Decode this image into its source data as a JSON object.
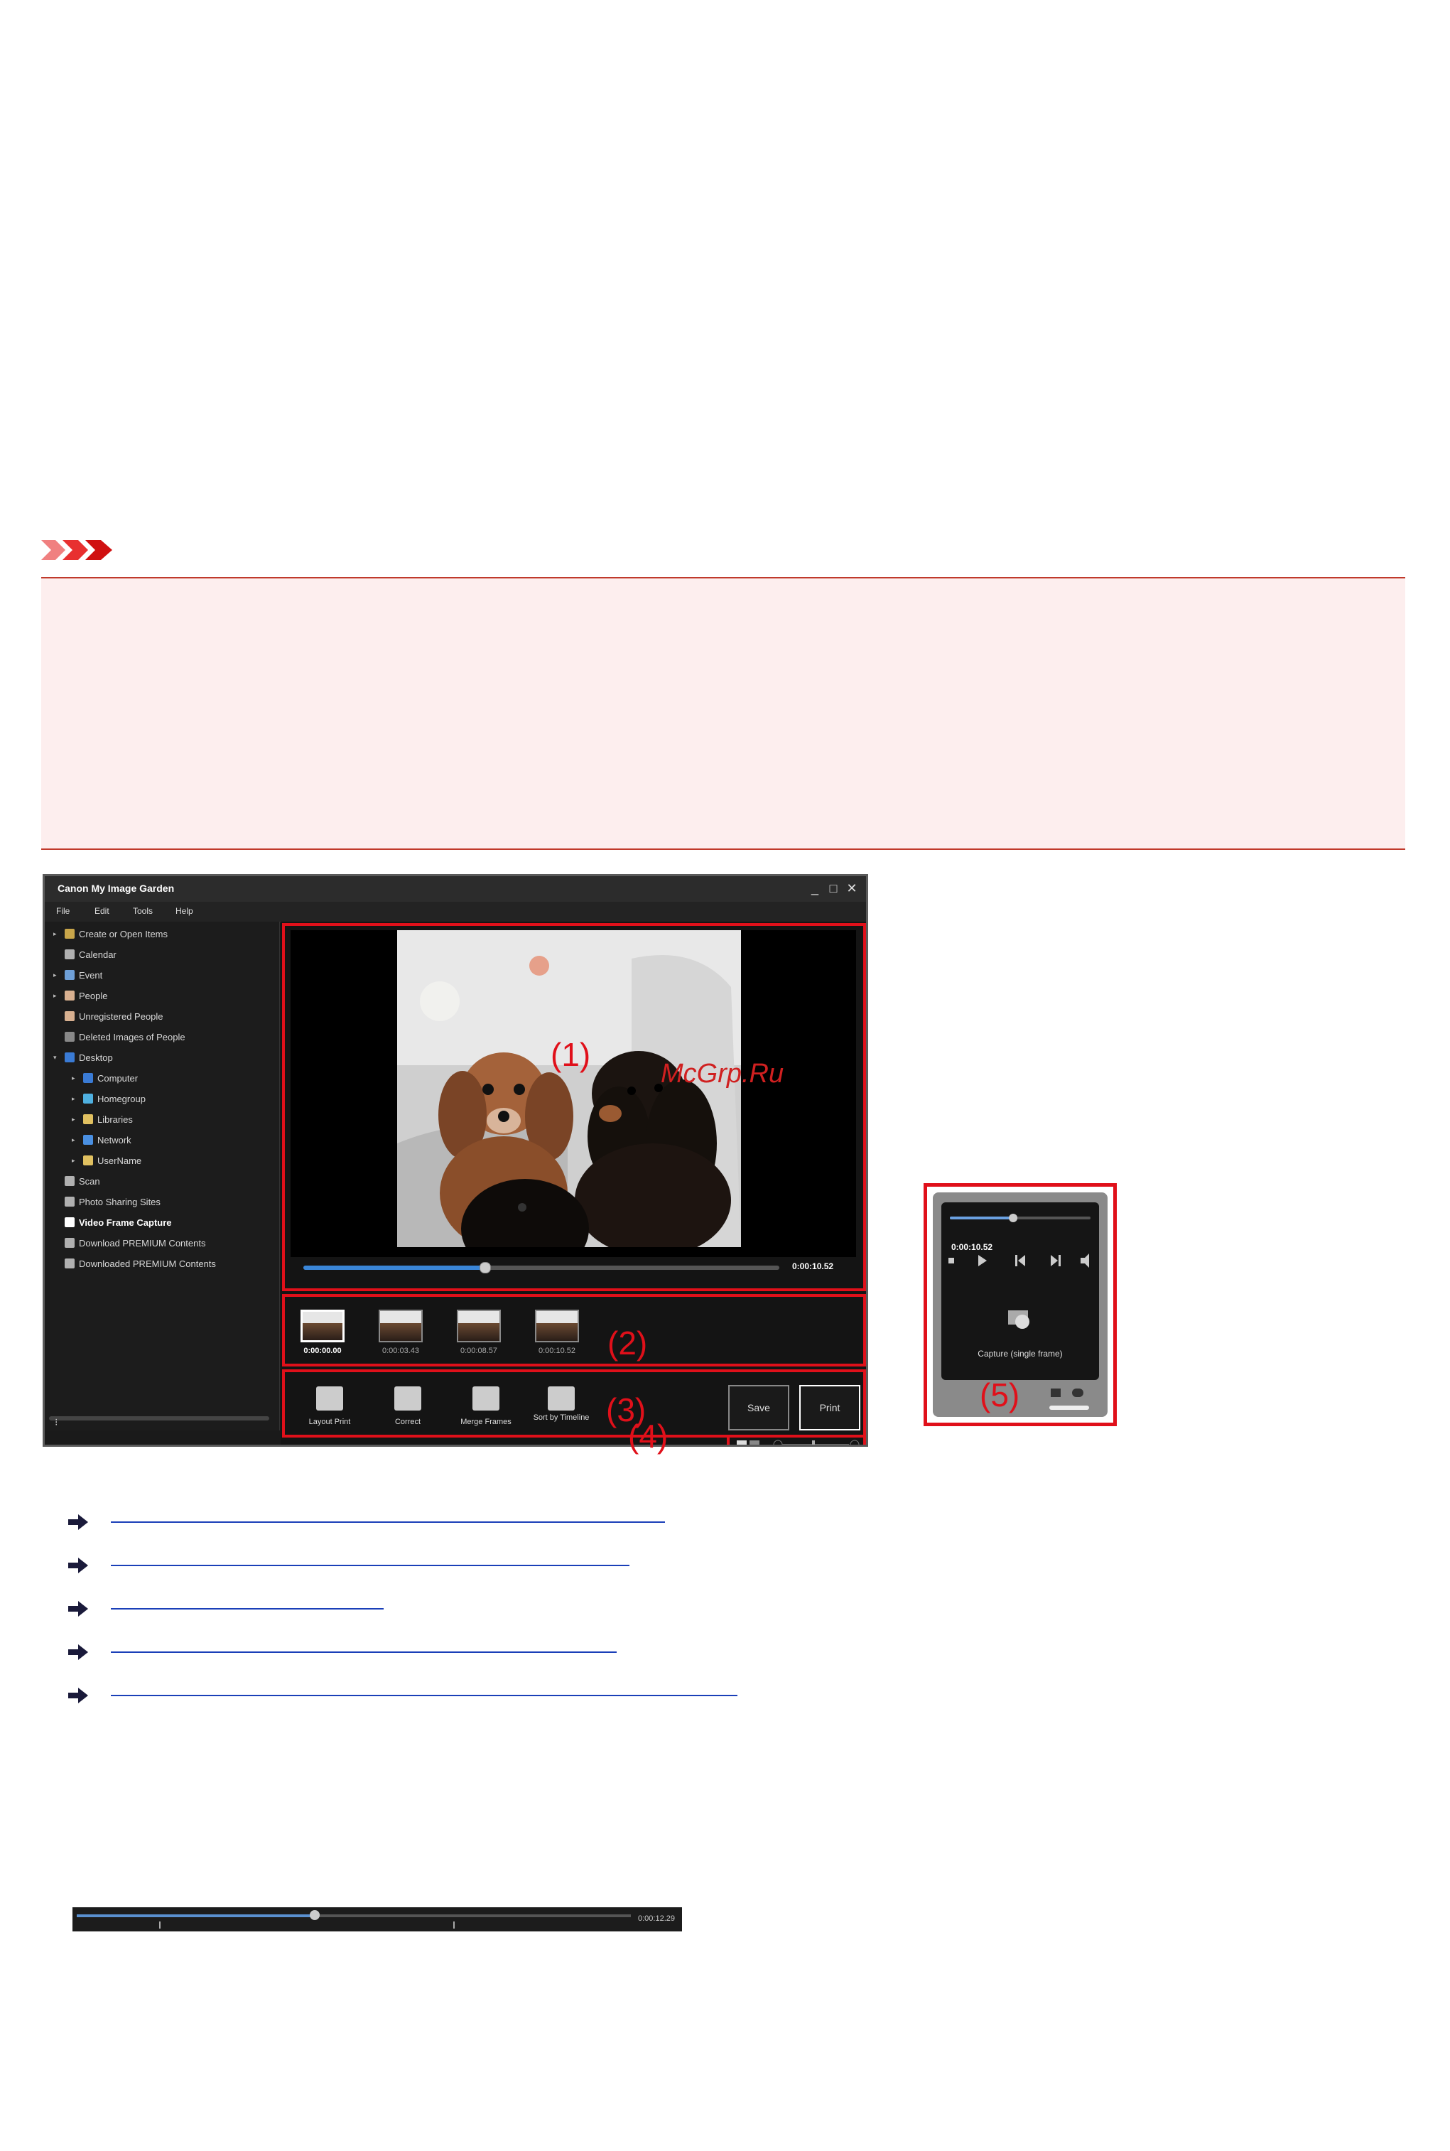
{
  "app": {
    "title": "Canon My Image Garden",
    "menu": [
      "File",
      "Edit",
      "Tools",
      "Help"
    ],
    "window_controls": [
      "_",
      "□",
      "✕"
    ]
  },
  "sidebar": {
    "items": [
      {
        "label": "Create or Open Items",
        "arrow": "▸",
        "icon": "create-icon",
        "color": "#c9a64a",
        "bold": false
      },
      {
        "label": "Calendar",
        "arrow": "",
        "icon": "calendar-icon",
        "color": "#b0b0b0",
        "bold": false
      },
      {
        "label": "Event",
        "arrow": "▸",
        "icon": "event-icon",
        "color": "#6fa0d8",
        "bold": false
      },
      {
        "label": "People",
        "arrow": "▸",
        "icon": "people-icon",
        "color": "#d8b090",
        "bold": false
      },
      {
        "label": "Unregistered People",
        "arrow": "",
        "icon": "person-icon",
        "color": "#d8b090",
        "bold": false
      },
      {
        "label": "Deleted Images of People",
        "arrow": "",
        "icon": "deleted-person-icon",
        "color": "#888888",
        "bold": false
      },
      {
        "label": "Desktop",
        "arrow": "▾",
        "icon": "desktop-icon",
        "color": "#3a7bd5",
        "bold": false
      },
      {
        "label": "Computer",
        "arrow": "▸",
        "icon": "computer-icon",
        "color": "#3a7bd5",
        "bold": false
      },
      {
        "label": "Homegroup",
        "arrow": "▸",
        "icon": "homegroup-icon",
        "color": "#4fb0e0",
        "bold": false
      },
      {
        "label": "Libraries",
        "arrow": "▸",
        "icon": "libraries-icon",
        "color": "#e0c060",
        "bold": false
      },
      {
        "label": "Network",
        "arrow": "▸",
        "icon": "network-icon",
        "color": "#4a90e2",
        "bold": false
      },
      {
        "label": "UserName",
        "arrow": "▸",
        "icon": "user-folder-icon",
        "color": "#e0c060",
        "bold": false
      },
      {
        "label": "Scan",
        "arrow": "",
        "icon": "scan-icon",
        "color": "#b0b0b0",
        "bold": false
      },
      {
        "label": "Photo Sharing Sites",
        "arrow": "",
        "icon": "photo-sharing-icon",
        "color": "#b0b0b0",
        "bold": false
      },
      {
        "label": "Video Frame Capture",
        "arrow": "",
        "icon": "video-frame-icon",
        "color": "#ffffff",
        "bold": true
      },
      {
        "label": "Download PREMIUM Contents",
        "arrow": "",
        "icon": "download-icon",
        "color": "#b0b0b0",
        "bold": false
      },
      {
        "label": "Downloaded PREMIUM Contents",
        "arrow": "",
        "icon": "downloaded-icon",
        "color": "#b0b0b0",
        "bold": false
      }
    ]
  },
  "preview": {
    "progress": 0.38,
    "time": "0:00:10.52"
  },
  "frames": [
    {
      "time": "0:00:00.00",
      "selected": true
    },
    {
      "time": "0:00:03.43",
      "selected": false
    },
    {
      "time": "0:00:08.57",
      "selected": false
    },
    {
      "time": "0:00:10.52",
      "selected": false
    }
  ],
  "tools": {
    "layout_print": "Layout Print",
    "correct": "Correct",
    "merge_frames": "Merge Frames",
    "sort_by_timeline": "Sort by Timeline",
    "save": "Save",
    "print": "Print"
  },
  "callouts": {
    "c1": "(1)",
    "c2": "(2)",
    "c3": "(3)",
    "c4": "(4)",
    "c5": "(5)"
  },
  "watermark": "McGrp.Ru",
  "panel": {
    "progress": 0.45,
    "time": "0:00:10.52",
    "capture_label": "Capture (single frame)"
  },
  "timeline_image": {
    "progress": 0.43,
    "time": "0:00:12.29"
  },
  "colors": {
    "accent_red": "#e0101a",
    "link_blue": "#1a3fb8",
    "notice_bg": "#fdeeee"
  }
}
